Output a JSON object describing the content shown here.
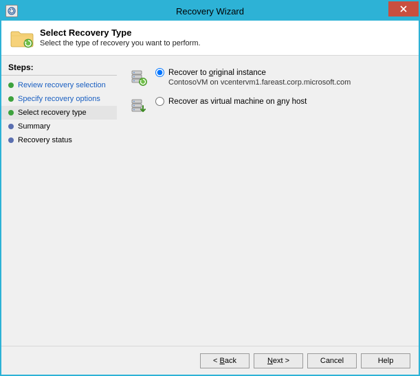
{
  "window": {
    "title": "Recovery Wizard"
  },
  "header": {
    "title": "Select Recovery Type",
    "subtitle": "Select the type of recovery you want to perform."
  },
  "steps": {
    "heading": "Steps:",
    "items": [
      {
        "label": "Review recovery selection",
        "state": "done",
        "link": true
      },
      {
        "label": "Specify recovery options",
        "state": "done",
        "link": true
      },
      {
        "label": "Select recovery type",
        "state": "done",
        "link": false,
        "current": true
      },
      {
        "label": "Summary",
        "state": "pending",
        "link": false
      },
      {
        "label": "Recovery status",
        "state": "pending",
        "link": false
      }
    ]
  },
  "options": {
    "original": {
      "label_pre": "Recover to ",
      "label_accel": "o",
      "label_post": "riginal instance",
      "desc": "ContosoVM on vcentervm1.fareast.corp.microsoft.com",
      "selected": true
    },
    "anyhost": {
      "label_pre": "Recover as virtual machine on ",
      "label_accel": "a",
      "label_post": "ny host",
      "selected": false
    }
  },
  "buttons": {
    "back_pre": "< ",
    "back_accel": "B",
    "back_post": "ack",
    "next_accel": "N",
    "next_post": "ext >",
    "cancel": "Cancel",
    "help": "Help"
  }
}
